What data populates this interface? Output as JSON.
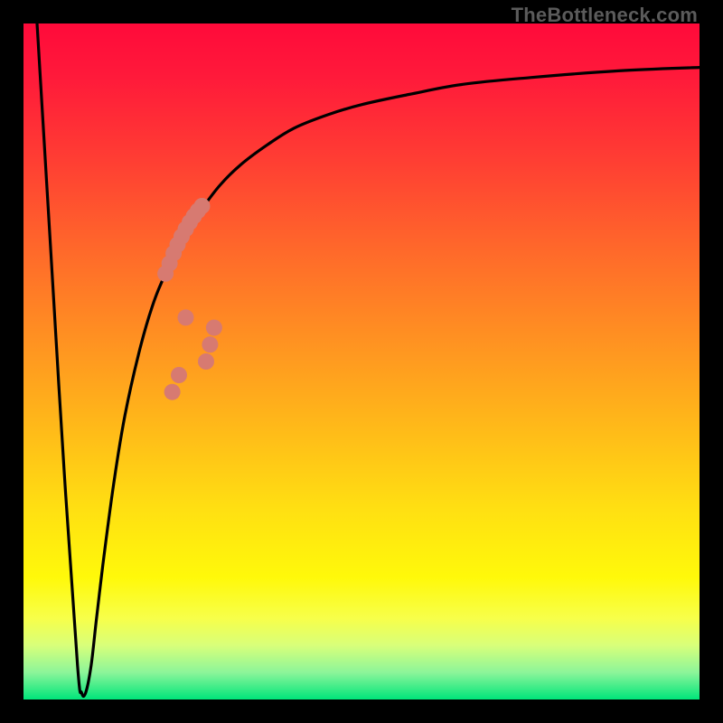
{
  "watermark": "TheBottleneck.com",
  "colors": {
    "background": "#000000",
    "curve": "#000000",
    "dots": "#d77a71",
    "gradient_stops": [
      "#ff0a3a",
      "#ff1a3a",
      "#ff3d33",
      "#ff6a2a",
      "#ff8f22",
      "#ffb41a",
      "#ffe012",
      "#fff90a",
      "#f7ff4a",
      "#d8ff7a",
      "#8cf59a",
      "#00e57a"
    ]
  },
  "chart_data": {
    "type": "line",
    "title": "",
    "xlabel": "",
    "ylabel": "",
    "xlim": [
      0,
      100
    ],
    "ylim": [
      0,
      100
    ],
    "grid": false,
    "legend": false,
    "series": [
      {
        "name": "black-curve",
        "x": [
          2,
          4,
          6,
          8,
          8.6,
          9.2,
          10,
          10.8,
          12,
          13.5,
          15,
          17,
          19,
          21,
          23.5,
          26,
          29,
          32,
          36,
          40,
          45,
          50,
          57,
          65,
          75,
          88,
          100
        ],
        "y": [
          100,
          67,
          34,
          5,
          1,
          1,
          5,
          12,
          22,
          33,
          42,
          51,
          58,
          63,
          68,
          72,
          76,
          79,
          82,
          84.5,
          86.5,
          88,
          89.5,
          91,
          92,
          93,
          93.5
        ]
      }
    ],
    "highlight_points": {
      "name": "salmon-dots",
      "x": [
        21.0,
        21.6,
        22.2,
        22.8,
        23.4,
        24.0,
        24.6,
        25.2,
        25.8,
        26.4,
        27.0,
        27.6,
        28.2,
        22.0,
        23.0,
        24.0
      ],
      "y": [
        63.0,
        64.5,
        66.0,
        67.3,
        68.5,
        69.6,
        70.6,
        71.5,
        72.3,
        73.0,
        50.0,
        52.5,
        55.0,
        45.5,
        48.0,
        56.5
      ]
    }
  }
}
